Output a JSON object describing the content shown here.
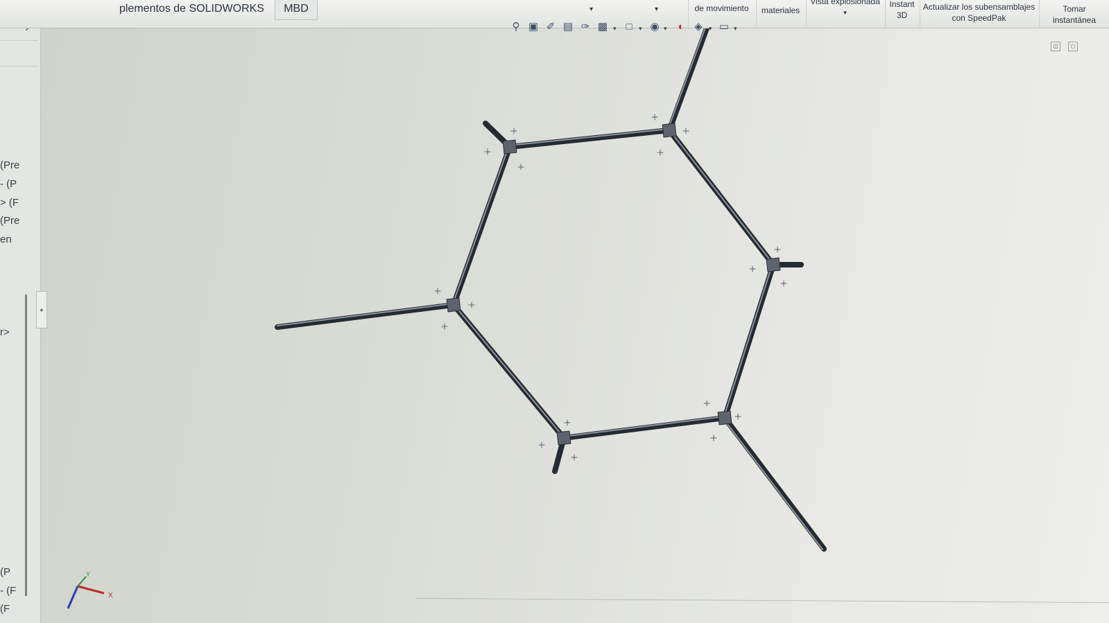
{
  "ribbon": {
    "tab_addins": "plementos de SOLIDWORKS",
    "tab_mbd": "MBD",
    "motion_study": "de movimiento",
    "materials": "materiales",
    "exploded_view": "Vista explosionada",
    "instant3d_line1": "Instant",
    "instant3d_line2": "3D",
    "speedpak_line1": "Actualizar los subensamblajes",
    "speedpak_line2": "con SpeedPak",
    "snapshot_line1": "Tomar",
    "snapshot_line2": "instantánea"
  },
  "hud_icons": [
    "zoom-to-fit-icon",
    "zoom-to-area-icon",
    "previous-view-icon",
    "section-view-icon",
    "dynamic-annotation-icon",
    "view-orientation-icon",
    "display-style-icon",
    "hide-show-icon",
    "appearance-icon",
    "scene-icon",
    "display-settings-icon"
  ],
  "tree": {
    "items": [
      "(Pre",
      "- (P",
      "> (F",
      "(Pre",
      "en",
      "r>",
      "(P",
      "- (F",
      "(F"
    ]
  },
  "triad": {
    "x_label": "X",
    "y_label": "Y"
  },
  "colors": {
    "background": "#dcded8",
    "beam": "#2f3540",
    "beam_highlight": "#8a919b",
    "accent_red": "#c0282a",
    "accent_blue": "#2a3fb0"
  }
}
